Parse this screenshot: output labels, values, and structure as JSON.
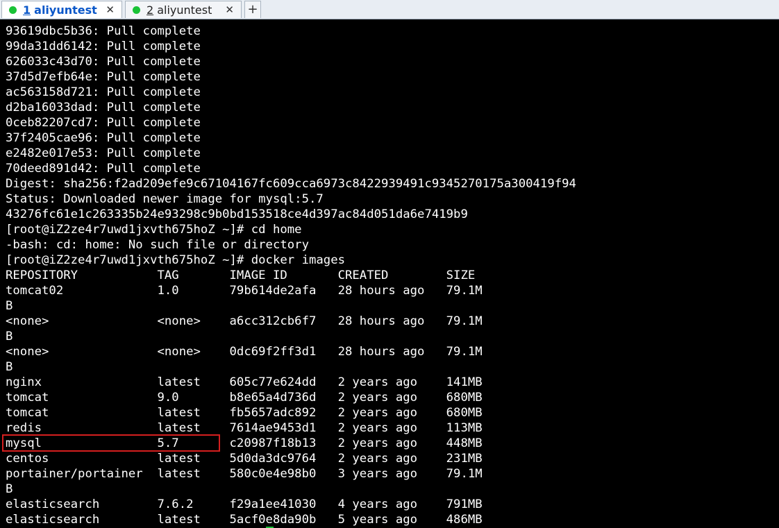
{
  "tabs": [
    {
      "number": "1",
      "name": "aliyuntest",
      "close": "✕",
      "active": true
    },
    {
      "number": "2",
      "name": "aliyuntest",
      "close": "✕",
      "active": false
    }
  ],
  "new_tab_label": "+",
  "colors": {
    "terminal_bg": "#000000",
    "terminal_fg": "#ffffff",
    "tab_status": "#19c236",
    "highlight_box": "#d51f1f",
    "active_tab_text": "#0a57c9"
  },
  "terminal_lines": [
    "93619dbc5b36: Pull complete",
    "99da31dd6142: Pull complete",
    "626033c43d70: Pull complete",
    "37d5d7efb64e: Pull complete",
    "ac563158d721: Pull complete",
    "d2ba16033dad: Pull complete",
    "0ceb82207cd7: Pull complete",
    "37f2405cae96: Pull complete",
    "e2482e017e53: Pull complete",
    "70deed891d42: Pull complete",
    "Digest: sha256:f2ad209efe9c67104167fc609cca6973c8422939491c9345270175a300419f94",
    "Status: Downloaded newer image for mysql:5.7",
    "43276fc61e1c263335b24e93298c9b0bd153518ce4d397ac84d051da6e7419b9",
    "[root@iZ2ze4r7uwd1jxvth675hoZ ~]# cd home",
    "-bash: cd: home: No such file or directory",
    "[root@iZ2ze4r7uwd1jxvth675hoZ ~]# docker images",
    "REPOSITORY           TAG       IMAGE ID       CREATED        SIZE",
    "tomcat02             1.0       79b614de2afa   28 hours ago   79.1M",
    "B",
    "<none>               <none>    a6cc312cb6f7   28 hours ago   79.1M",
    "B",
    "<none>               <none>    0dc69f2ff3d1   28 hours ago   79.1M",
    "B",
    "nginx                latest    605c77e624dd   2 years ago    141MB",
    "tomcat               9.0       b8e65a4d736d   2 years ago    680MB",
    "tomcat               latest    fb5657adc892   2 years ago    680MB",
    "redis                latest    7614ae9453d1   2 years ago    113MB",
    "mysql                5.7       c20987f18b13   2 years ago    448MB",
    "centos               latest    5d0da3dc9764   2 years ago    231MB",
    "portainer/portainer  latest    580c0e4e98b0   3 years ago    79.1M",
    "B",
    "elasticsearch        7.6.2     f29a1ee41030   4 years ago    791MB",
    "elasticsearch        latest    5acf0e8da90b   5 years ago    486MB"
  ]
}
